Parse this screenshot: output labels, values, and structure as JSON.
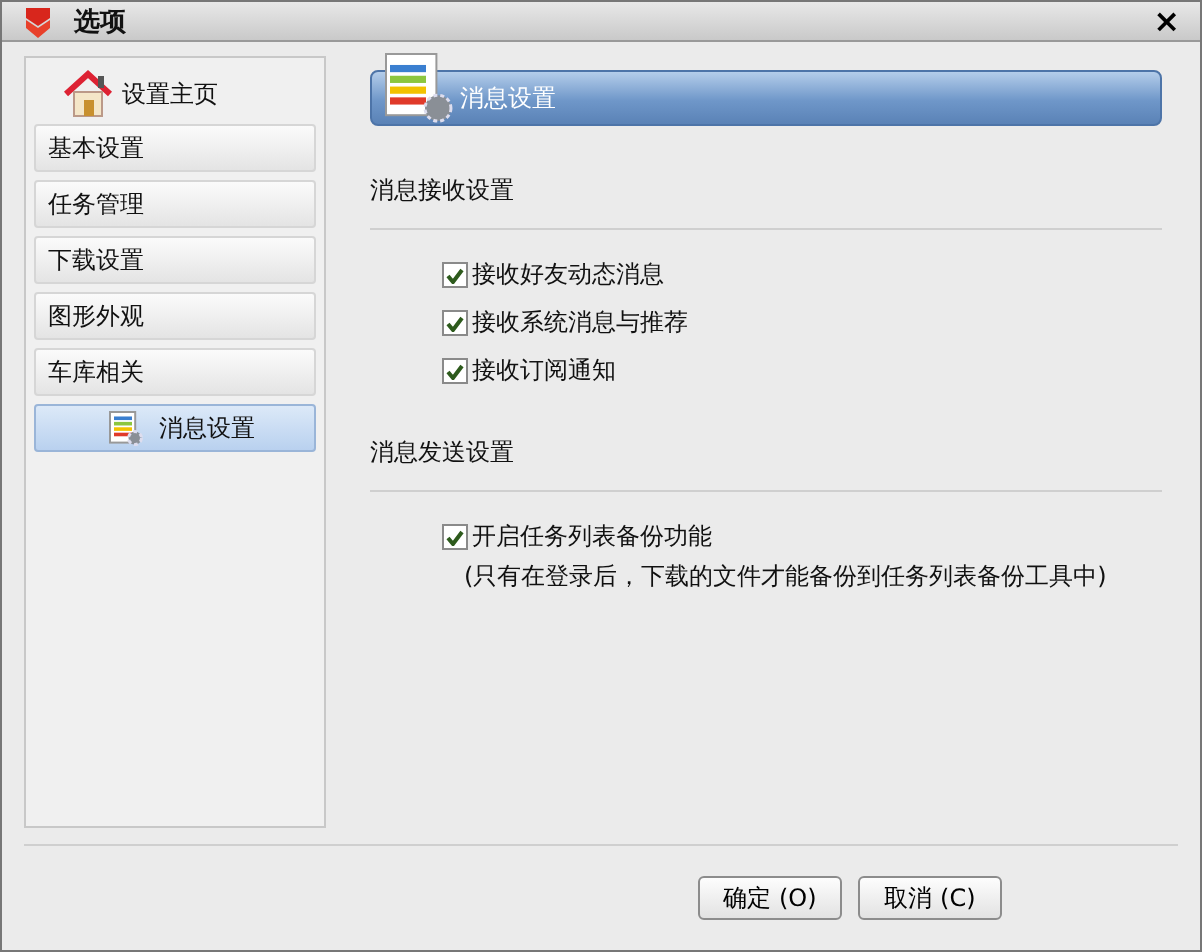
{
  "window": {
    "title": "选项",
    "close": "×"
  },
  "sidebar": {
    "items": [
      {
        "kind": "home",
        "label": "设置主页",
        "selected": false
      },
      {
        "kind": "tab",
        "label": "基本设置",
        "selected": false
      },
      {
        "kind": "tab",
        "label": "任务管理",
        "selected": false
      },
      {
        "kind": "tab",
        "label": "下载设置",
        "selected": false
      },
      {
        "kind": "tab",
        "label": "图形外观",
        "selected": false
      },
      {
        "kind": "tab",
        "label": "车库相关",
        "selected": false
      },
      {
        "kind": "tab",
        "label": "消息设置",
        "selected": true
      }
    ]
  },
  "header": {
    "title": "消息设置"
  },
  "sections": [
    {
      "title": "消息接收设置",
      "options": [
        {
          "label": "接收好友动态消息",
          "checked": true
        },
        {
          "label": "接收系统消息与推荐",
          "checked": true
        },
        {
          "label": "接收订阅通知",
          "checked": true
        }
      ]
    },
    {
      "title": "消息发送设置",
      "options": [
        {
          "label": "开启任务列表备份功能",
          "checked": true,
          "note": "(只有在登录后，下载的文件才能备份到任务列表备份工具中)"
        }
      ]
    }
  ],
  "buttons": [
    {
      "label": "确定 (O)"
    },
    {
      "label": "取消 (C)"
    }
  ]
}
